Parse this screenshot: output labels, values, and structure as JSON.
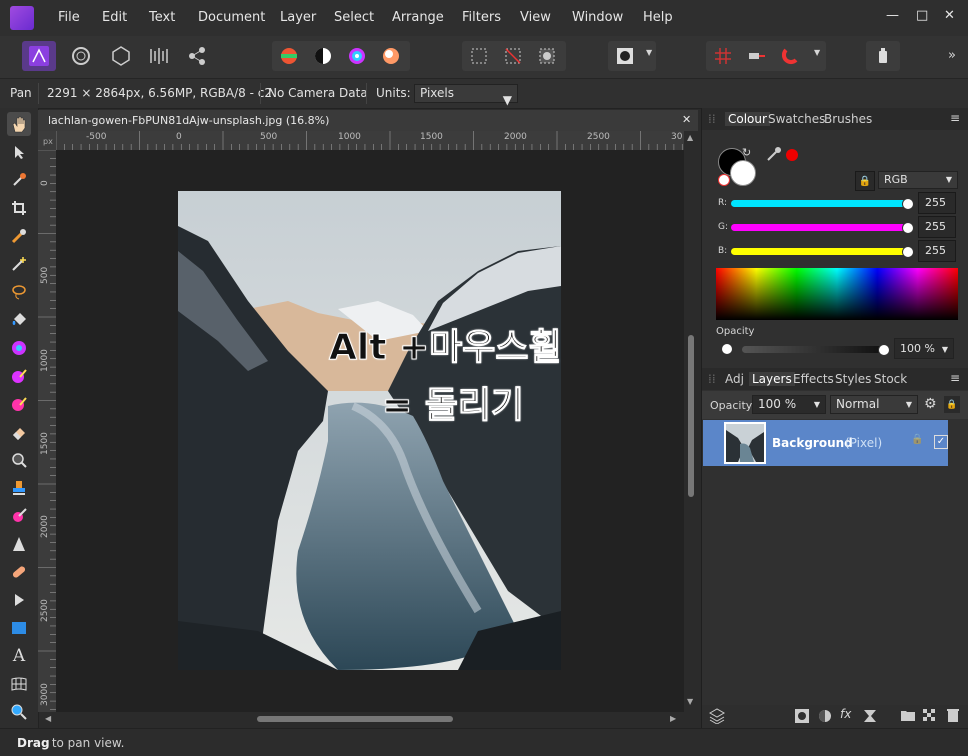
{
  "app": {
    "name": "Affinity Photo"
  },
  "menu": [
    "File",
    "Edit",
    "Text",
    "Document",
    "Layer",
    "Select",
    "Arrange",
    "Filters",
    "View",
    "Window",
    "Help"
  ],
  "window_controls": {
    "minimize": "—",
    "maximize": "□",
    "close": "✕"
  },
  "context": {
    "tool_name": "Pan",
    "doc_info": "2291 × 2864px, 6.56MP, RGBA/8 - c2",
    "camera": "No Camera Data",
    "units_label": "Units:",
    "units_value": "Pixels"
  },
  "document": {
    "tab_title": "lachlan-gowen-FbPUN81dAjw-unsplash.jpg (16.8%)",
    "close": "✕",
    "ruler_unit": "px",
    "h_ruler_ticks": [
      "-500",
      "0",
      "500",
      "1000",
      "1500",
      "2000",
      "2500",
      "30"
    ],
    "v_ruler_ticks": [
      "0",
      "500",
      "1000",
      "1500",
      "2000",
      "2500",
      "3000"
    ],
    "annotation_line1": "Alt +마우스휠",
    "annotation_line2": "= 돌리기"
  },
  "colour_panel": {
    "tabs": [
      "Colour",
      "Swatches",
      "Brushes"
    ],
    "active_tab": "Colour",
    "model": "RGB",
    "channels": [
      {
        "label": "R:",
        "value": "255",
        "color": "#00e5ff"
      },
      {
        "label": "G:",
        "value": "255",
        "color": "#ff00ff"
      },
      {
        "label": "B:",
        "value": "255",
        "color": "#ffff00"
      }
    ],
    "opacity_label": "Opacity",
    "opacity_value": "100 %"
  },
  "layers_panel": {
    "tabs": [
      "Adj",
      "Layers",
      "Effects",
      "Styles",
      "Stock"
    ],
    "active_tab": "Layers",
    "opacity_label": "Opacity:",
    "opacity_value": "100 %",
    "blend_mode": "Normal",
    "layers": [
      {
        "name": "Background",
        "type": "(Pixel)",
        "selected": true
      }
    ]
  },
  "status": {
    "bold": "Drag",
    "text": " to pan view."
  },
  "colors": {
    "accent": "#5a7fc4",
    "layer_selected": "#5b86c9",
    "app_purple": "#8b3fe0"
  }
}
